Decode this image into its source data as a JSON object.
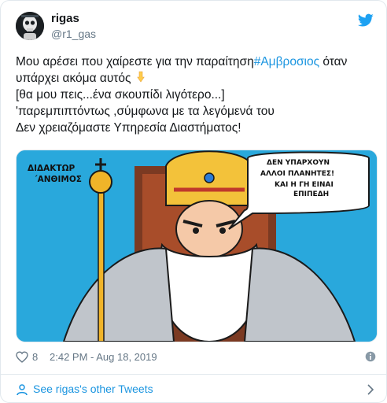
{
  "author": {
    "name": "rigas",
    "handle": "@r1_gas",
    "avatar": "skeleton-avatar"
  },
  "header": {
    "logo_icon": "twitter-bird-icon"
  },
  "tweet": {
    "line1_before": "Μου αρέσει που χαίρεστε για την παραίτηση",
    "hashtag": "#Αμβροσιος",
    "line1_after": " όταν",
    "line2": "υπάρχει ακόμα αυτός",
    "line2_emoji": "pointing-down-emoji",
    "line3": "[θα μου πεις...ένα σκουπίδι λιγότερο...]",
    "line4": "'παρεμπιπτόντως ,σύμφωνα με τα λεγόμενά του",
    "line5": "Δεν χρειαζόμαστε Υπηρεσία Διαστήματος!"
  },
  "media": {
    "type": "cartoon-image",
    "caption_line1": "ΔΙΔΑΚΤΩΡ",
    "caption_line2": "΄ΑΝΘΙΜΟΣ",
    "bubble_line1": "ΔΕΝ ΥΠΑΡΧΟΥΝ",
    "bubble_line2": "ΑΛΛΟΙ ΠΛΑΝΗΤΕΣ!",
    "bubble_line3": "ΚΑΙ Η ΓΗ ΕΙΝΑΙ",
    "bubble_line4": "ΕΠΙΠΕΔΗ"
  },
  "stats": {
    "likes": "8",
    "timestamp": "2:42 PM - Aug 18, 2019"
  },
  "footer": {
    "label": "See rigas's other Tweets"
  },
  "colors": {
    "link": "#1b95e0",
    "muted": "#657786",
    "text": "#14171a",
    "media_bg": "#29a8dc"
  }
}
